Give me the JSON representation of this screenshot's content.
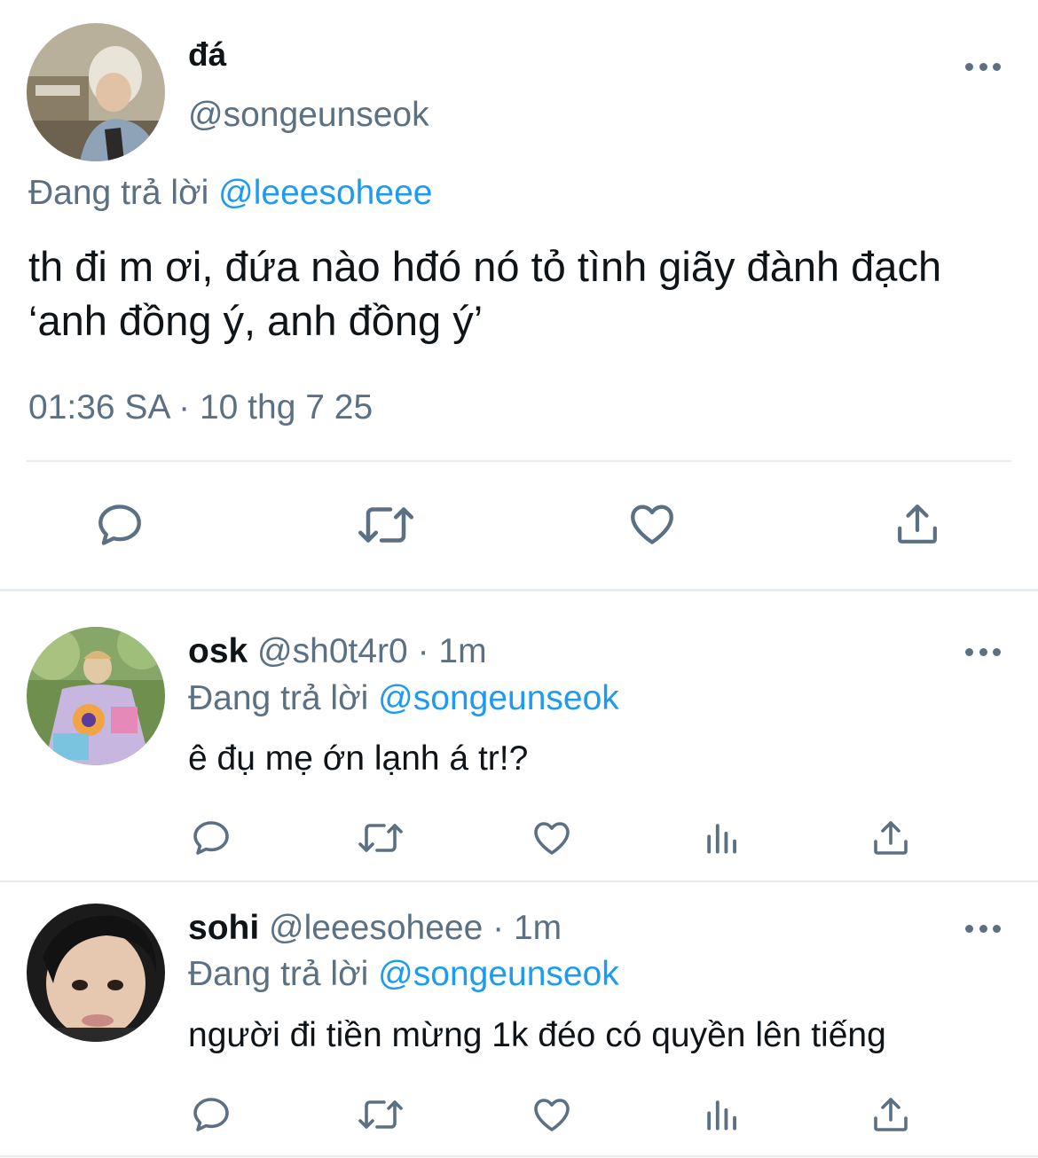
{
  "main_tweet": {
    "name": "đá",
    "handle": "@songeunseok",
    "replying_prefix": "Đang trả lời",
    "replying_to": "@leeesoheee",
    "text": "th đi m ơi, đứa nào hđó nó tỏ tình giãy đành đạch ‘anh đồng ý, anh đồng ý’",
    "timestamp": "01:36 SA · 10 thg 7 25",
    "actions": [
      "reply-icon",
      "retweet-icon",
      "like-icon",
      "share-icon"
    ]
  },
  "replies": [
    {
      "name": "osk",
      "handle": "@sh0t4r0",
      "separator": "·",
      "time": "1m",
      "replying_prefix": "Đang trả lời",
      "replying_to": "@songeunseok",
      "text": "ê đụ mẹ ớn lạnh á tr!?"
    },
    {
      "name": "sohi",
      "handle": "@leeesoheee",
      "separator": "·",
      "time": "1m",
      "replying_prefix": "Đang trả lời",
      "replying_to": "@songeunseok",
      "text": "người đi tiền mừng 1k đéo có quyền lên tiếng"
    }
  ],
  "colors": {
    "text": "#0f1419",
    "secondary": "#5b7083",
    "link": "#1d9bf0",
    "divider": "#e6ecf0"
  }
}
